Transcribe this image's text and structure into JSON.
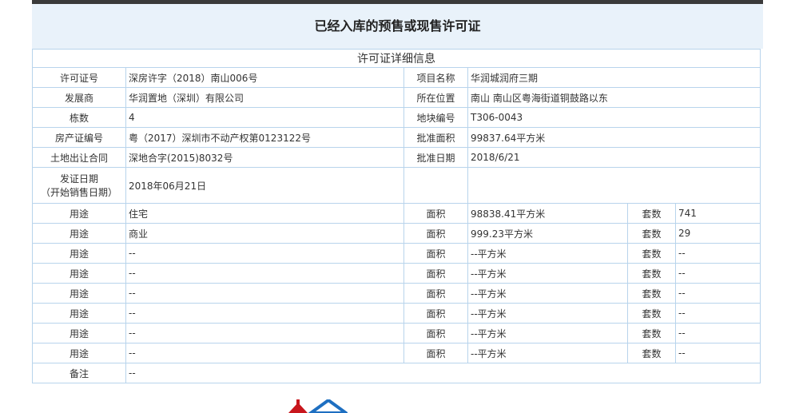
{
  "page": {
    "title": "已经入库的预售或现售许可证"
  },
  "table": {
    "header": "许可证详细信息",
    "rows": {
      "permit_no_label": "许可证号",
      "permit_no": "深房许字（2018）南山006号",
      "project_label": "项目名称",
      "project": "华润城润府三期",
      "developer_label": "发展商",
      "developer": "华润置地（深圳）有限公司",
      "location_label": "所在位置",
      "location": "南山 南山区粤海街道铜鼓路以东",
      "buildings_label": "栋数",
      "buildings": "4",
      "plot_label": "地块编号",
      "plot": "T306-0043",
      "cert_label": "房产证编号",
      "cert": "粤（2017）深圳市不动产权第0123122号",
      "approved_area_label": "批准面积",
      "approved_area": "99837.64平方米",
      "land_contract_label": "土地出让合同",
      "land_contract": "深地合字(2015)8032号",
      "approved_date_label": "批准日期",
      "approved_date": "2018/6/21",
      "issue_date_label_1": "发证日期",
      "issue_date_label_2": "（开始销售日期）",
      "issue_date": "2018年06月21日"
    },
    "usage_rows": [
      {
        "use_label": "用途",
        "use": "住宅",
        "area_label": "面积",
        "area": "98838.41平方米",
        "units_label": "套数",
        "units": "741"
      },
      {
        "use_label": "用途",
        "use": "商业",
        "area_label": "面积",
        "area": "999.23平方米",
        "units_label": "套数",
        "units": "29"
      },
      {
        "use_label": "用途",
        "use": "--",
        "area_label": "面积",
        "area": "--平方米",
        "units_label": "套数",
        "units": "--"
      },
      {
        "use_label": "用途",
        "use": "--",
        "area_label": "面积",
        "area": "--平方米",
        "units_label": "套数",
        "units": "--"
      },
      {
        "use_label": "用途",
        "use": "--",
        "area_label": "面积",
        "area": "--平方米",
        "units_label": "套数",
        "units": "--"
      },
      {
        "use_label": "用途",
        "use": "--",
        "area_label": "面积",
        "area": "--平方米",
        "units_label": "套数",
        "units": "--"
      },
      {
        "use_label": "用途",
        "use": "--",
        "area_label": "面积",
        "area": "--平方米",
        "units_label": "套数",
        "units": "--"
      },
      {
        "use_label": "用途",
        "use": "--",
        "area_label": "面积",
        "area": "--平方米",
        "units_label": "套数",
        "units": "--"
      }
    ],
    "remarks_label": "备注",
    "remarks": "--"
  },
  "colors": {
    "border": "#b8d4ec",
    "title_bg": "#e9f2fa",
    "logo_red": "#c8161d",
    "logo_blue": "#1e6fc1"
  },
  "icons": {
    "footer": "housing-authority-logo-icon"
  }
}
